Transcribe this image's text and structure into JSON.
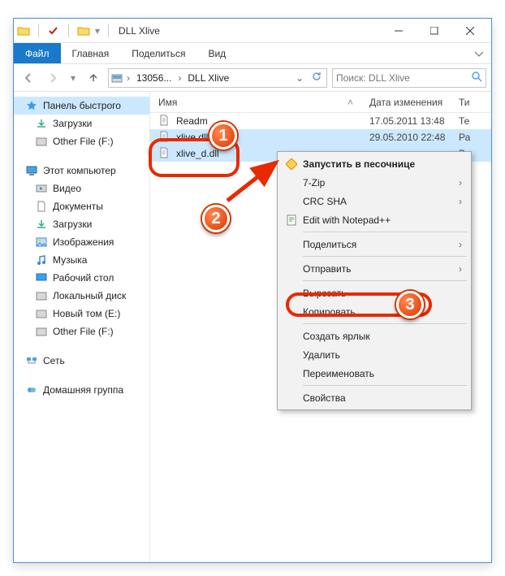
{
  "window": {
    "title": "DLL Xlive"
  },
  "tabs": {
    "file": "Файл",
    "home": "Главная",
    "share": "Поделиться",
    "view": "Вид"
  },
  "address": {
    "seg1": "13056...",
    "seg2": "DLL Xlive"
  },
  "search": {
    "placeholder": "Поиск: DLL Xlive"
  },
  "columns": {
    "name": "Имя",
    "date": "Дата изменения",
    "type": "Ти"
  },
  "sidebar": {
    "quick": "Панель быстрого",
    "downloads": "Загрузки",
    "otherf": "Other File (F:)",
    "thispc": "Этот компьютер",
    "videos": "Видео",
    "documents": "Документы",
    "downloads2": "Загрузки",
    "pictures": "Изображения",
    "music": "Музыка",
    "desktop": "Рабочий стол",
    "localdisk": "Локальный диск",
    "newvol": "Новый том (E:)",
    "otherf2": "Other File (F:)",
    "network": "Сеть",
    "homegroup": "Домашняя группа"
  },
  "files": [
    {
      "name": "Readm",
      "date": "17.05.2011 13:48",
      "type": "Те",
      "selected": false
    },
    {
      "name": "xlive.dll",
      "date": "29.05.2010 22:48",
      "type": "Ра",
      "selected": true
    },
    {
      "name": "xlive_d.dll",
      "date": "",
      "type": "Ра",
      "selected": true
    }
  ],
  "context": {
    "sandbox": "Запустить в песочнице",
    "sevenzip": "7-Zip",
    "crcsha": "CRC SHA",
    "notepadpp": "Edit with Notepad++",
    "share": "Поделиться",
    "sendto": "Отправить",
    "cut": "Вырезать",
    "copy": "Копировать",
    "shortcut": "Создать ярлык",
    "delete": "Удалить",
    "rename": "Переименовать",
    "properties": "Свойства"
  },
  "callouts": {
    "one": "1",
    "two": "2",
    "three": "3"
  },
  "colors": {
    "accent": "#1979ca",
    "selection": "#cce8ff",
    "calloutRed": "#e82a00"
  }
}
